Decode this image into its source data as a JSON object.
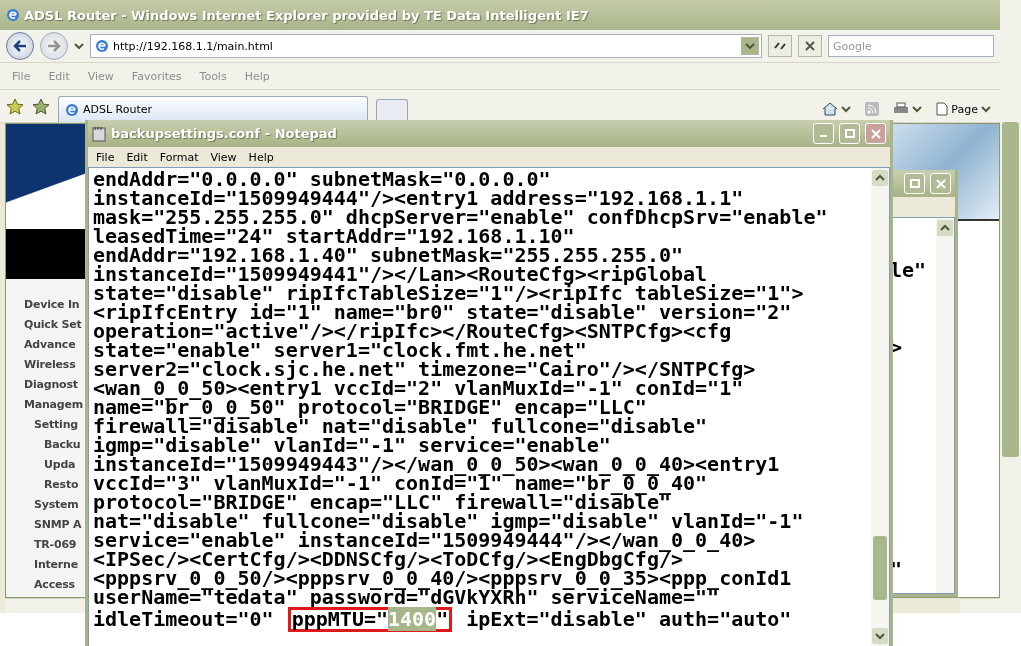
{
  "browser": {
    "title": "ADSL Router - Windows Internet Explorer provided by TE Data Intelligent IE7",
    "address": "http://192.168.1.1/main.html",
    "search": {
      "placeholder": "Google"
    },
    "menu": [
      "File",
      "Edit",
      "View",
      "Favorites",
      "Tools",
      "Help"
    ],
    "tabs": [
      {
        "label": "ADSL Router",
        "selected": true
      }
    ],
    "command_bar": {
      "page_label": "Page"
    }
  },
  "router_page": {
    "sidebar": [
      {
        "label": "Device In"
      },
      {
        "label": "Quick Set"
      },
      {
        "label": "Advance"
      },
      {
        "label": "Wireless"
      },
      {
        "label": "Diagnost"
      },
      {
        "label": "Managem",
        "children": [
          {
            "label": "Setting",
            "children": [
              {
                "label": "Backu"
              },
              {
                "label": "Upda"
              },
              {
                "label": "Resto"
              }
            ]
          },
          {
            "label": "System"
          },
          {
            "label": "SNMP A"
          },
          {
            "label": "TR-069"
          },
          {
            "label": "Interne"
          },
          {
            "label": "Access"
          }
        ]
      }
    ]
  },
  "back_window": {
    "fragments": [
      "le\"",
      ">",
      "\""
    ]
  },
  "notepad": {
    "title": "backupsettings.conf - Notepad",
    "menu": [
      "File",
      "Edit",
      "Format",
      "View",
      "Help"
    ],
    "lines": [
      "endAddr=\"0.0.0.0\" subnetMask=\"0.0.0.0\"",
      "instanceId=\"1509949444\"/><entry1 address=\"192.168.1.1\"",
      "mask=\"255.255.255.0\" dhcpServer=\"enable\" confDhcpSrv=\"enable\"",
      "leasedTime=\"24\" startAddr=\"192.168.1.10\"",
      "endAddr=\"192.168.1.40\" subnetMask=\"255.255.255.0\"",
      "instanceId=\"1509949441\"/></Lan><RouteCfg><ripGlobal",
      "state=\"disable\" ripIfcTableSize=\"1\"/><ripIfc tableSize=\"1\">",
      "<ripIfcEntry id=\"1\" name=\"br0\" state=\"disable\" version=\"2\"",
      "operation=\"active\"/></ripIfc></RouteCfg><SNTPCfg><cfg",
      "state=\"enable\" server1=\"clock.fmt.he.net\"",
      "server2=\"clock.sjc.he.net\" timezone=\"Cairo\"/></SNTPCfg>",
      "<wan_0_0_50><entry1 vccId=\"2\" vlanMuxId=\"-1\" conId=\"1\"",
      "name=\"br_0_0_50\" protocol=\"BRIDGE\" encap=\"LLC\"",
      "firewall=\"disable\" nat=\"disable\" fullcone=\"disable\"",
      "igmp=\"disable\" vlanId=\"-1\" service=\"enable\"",
      "instanceId=\"1509949443\"/></wan_0_0_50><wan_0_0_40><entry1",
      "vccId=\"3\" vlanMuxId=\"-1\" conId=\"1\" name=\"br_0_0_40\"",
      "protocol=\"BRIDGE\" encap=\"LLC\" firewall=\"disable\"",
      "nat=\"disable\" fullcone=\"disable\" igmp=\"disable\" vlanId=\"-1\"",
      "service=\"enable\" instanceId=\"1509949444\"/></wan_0_0_40>",
      "<IPSec/><CertCfg/><DDNSCfg/><ToDCfg/><EngDbgCfg/>",
      "<pppsrv_0_0_50/><pppsrv_0_0_40/><pppsrv_0_0_35><ppp_conId1",
      "userName=\"tedata\" password=\"dGVkYXRh\" serviceName=\"\""
    ],
    "last_line": {
      "before": "idleTimeout=\"0\"",
      "framed_key": "pppMTU=\"",
      "selected_text": "1400",
      "framed_end": "\"",
      "after": "ipExt=\"disable\" auth=\"auto\""
    }
  }
}
